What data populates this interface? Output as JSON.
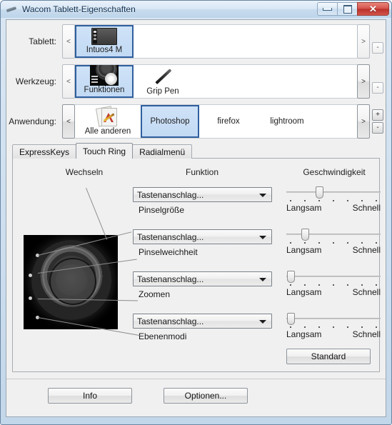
{
  "window": {
    "title": "Wacom Tablett-Eigenschaften",
    "icon": "pen-icon",
    "buttons": {
      "minimize": "minimize-icon",
      "maximize": "maximize-icon",
      "close": "✕"
    }
  },
  "selectors": [
    {
      "label": "Tablett:",
      "prev": "<",
      "next": ">",
      "plus": "",
      "minus": "-",
      "has_plus": false,
      "items": [
        {
          "label": "Intuos4 M",
          "icon": "tablet-icon",
          "selected": true
        }
      ]
    },
    {
      "label": "Werkzeug:",
      "prev": "<",
      "next": ">",
      "plus": "",
      "minus": "-",
      "has_plus": false,
      "items": [
        {
          "label": "Funktionen",
          "icon": "functions-icon",
          "selected": true
        },
        {
          "label": "Grip Pen",
          "icon": "pen-icon",
          "selected": false
        }
      ]
    },
    {
      "label": "Anwendung:",
      "prev": "<",
      "next": ">",
      "plus": "+",
      "minus": "-",
      "has_plus": true,
      "items": [
        {
          "label": "Alle anderen",
          "icon": "all-others-icon",
          "selected": false
        },
        {
          "label": "Photoshop",
          "icon": "",
          "selected": true
        },
        {
          "label": "firefox",
          "icon": "",
          "selected": false
        },
        {
          "label": "lightroom",
          "icon": "",
          "selected": false
        }
      ]
    }
  ],
  "tabs": [
    {
      "label": "ExpressKeys",
      "active": false
    },
    {
      "label": "Touch Ring",
      "active": true
    },
    {
      "label": "Radialmenü",
      "active": false
    }
  ],
  "panel": {
    "column_headers": {
      "switch": "Wechseln",
      "function": "Funktion",
      "speed": "Geschwindigkeit"
    },
    "ring_image": "touch-ring-illustration",
    "rows": [
      {
        "function_value": "Tastenanschlag...",
        "caption": "Pinselgröße",
        "speed_min": "Langsam",
        "speed_max": "Schnell",
        "speed_tick": 3,
        "speed_ticks_total": 7
      },
      {
        "function_value": "Tastenanschlag...",
        "caption": "Pinselweichheit",
        "speed_min": "Langsam",
        "speed_max": "Schnell",
        "speed_tick": 2,
        "speed_ticks_total": 7
      },
      {
        "function_value": "Tastenanschlag...",
        "caption": "Zoomen",
        "speed_min": "Langsam",
        "speed_max": "Schnell",
        "speed_tick": 1,
        "speed_ticks_total": 7
      },
      {
        "function_value": "Tastenanschlag...",
        "caption": "Ebenenmodi",
        "speed_min": "Langsam",
        "speed_max": "Schnell",
        "speed_tick": 1,
        "speed_ticks_total": 7
      }
    ],
    "default_button": "Standard"
  },
  "footer": {
    "info_button": "Info",
    "options_button": "Optionen..."
  },
  "colors": {
    "selection_fill": "#c7def5",
    "selection_border": "#2f5f9e",
    "panel_bg": "#f0f0f0",
    "title_gradient_top": "#e9f1fa",
    "close_red": "#c0392b"
  }
}
